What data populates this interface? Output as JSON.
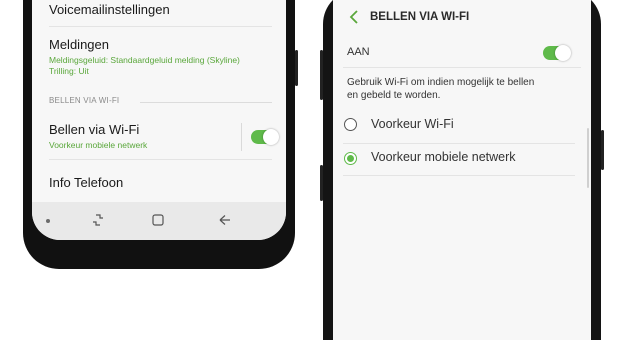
{
  "left_screen": {
    "items": [
      {
        "title": "Voicemailinstellingen"
      },
      {
        "title": "Meldingen",
        "sub1": "Meldingsgeluid: Standaardgeluid melding (Skyline)",
        "sub2": "Trilling: Uit"
      }
    ],
    "section_header": "BELLEN VIA WI-FI",
    "wifi_item": {
      "title": "Bellen via Wi-Fi",
      "sub": "Voorkeur mobiele netwerk",
      "toggle_on": true
    },
    "info_item": {
      "title": "Info Telefoon"
    },
    "navbar": {
      "icons": [
        "recent-apps-icon",
        "home-icon",
        "back-icon"
      ]
    }
  },
  "right_screen": {
    "header_title": "BELLEN VIA WI-FI",
    "master_switch": {
      "label": "AAN",
      "on": true
    },
    "description": [
      "Gebruik Wi-Fi om indien mogelijk te bellen",
      "en gebeld te worden."
    ],
    "options": [
      {
        "label": "Voorkeur Wi-Fi",
        "selected": false
      },
      {
        "label": "Voorkeur mobiele netwerk",
        "selected": true
      }
    ]
  },
  "colors": {
    "accent": "#5fba4a",
    "accent_text": "#5aa73b",
    "frame": "#111111"
  }
}
